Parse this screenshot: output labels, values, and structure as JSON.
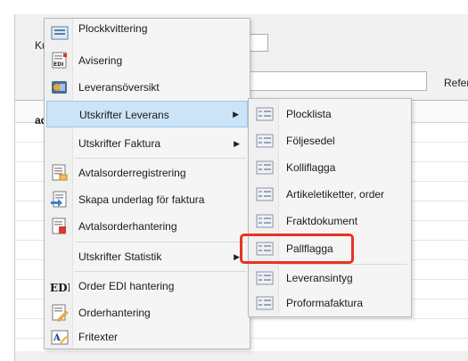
{
  "background": {
    "field_label_ku": "Ku",
    "column_label_ad": "ad",
    "field_label_refer": "Refer"
  },
  "menu": {
    "items": [
      {
        "label": "Plockkvittering",
        "icon": "document-receipt-icon"
      },
      {
        "label": "Avisering",
        "icon": "edi-document-icon"
      },
      {
        "label": "Leveransöversikt",
        "icon": "delivery-overview-icon"
      },
      {
        "label": "Utskrifter Leverans",
        "icon": "",
        "submenu": true,
        "active": true
      },
      {
        "label": "Utskrifter Faktura",
        "icon": "",
        "submenu": true
      },
      {
        "label": "Avtalsorderregistrering",
        "icon": "contract-order-icon"
      },
      {
        "label": "Skapa underlag för faktura",
        "icon": "invoice-basis-icon"
      },
      {
        "label": "Avtalsorderhantering",
        "icon": "contract-handling-icon"
      },
      {
        "label": "Utskrifter Statistik",
        "icon": "",
        "submenu": true
      },
      {
        "label": "Order EDI hantering",
        "icon": "edi-text-icon",
        "edi_text": "EDI"
      },
      {
        "label": "Orderhantering",
        "icon": "order-handling-icon"
      },
      {
        "label": "Fritexter",
        "icon": "free-text-icon"
      }
    ]
  },
  "submenu": {
    "items": [
      {
        "label": "Plocklista",
        "icon": "report-icon"
      },
      {
        "label": "Följesedel",
        "icon": "report-icon"
      },
      {
        "label": "Kolliflagga",
        "icon": "report-icon"
      },
      {
        "label": "Artikeletiketter, order",
        "icon": "report-icon"
      },
      {
        "label": "Fraktdokument",
        "icon": "report-icon"
      },
      {
        "label": "Pallflagga",
        "icon": "report-icon",
        "highlighted": true
      },
      {
        "label": "Leveransintyg",
        "icon": "report-icon"
      },
      {
        "label": "Proformafaktura",
        "icon": "report-icon"
      }
    ]
  },
  "colors": {
    "active_item_bg": "#cce4f7",
    "highlight_border": "#e8331f"
  }
}
